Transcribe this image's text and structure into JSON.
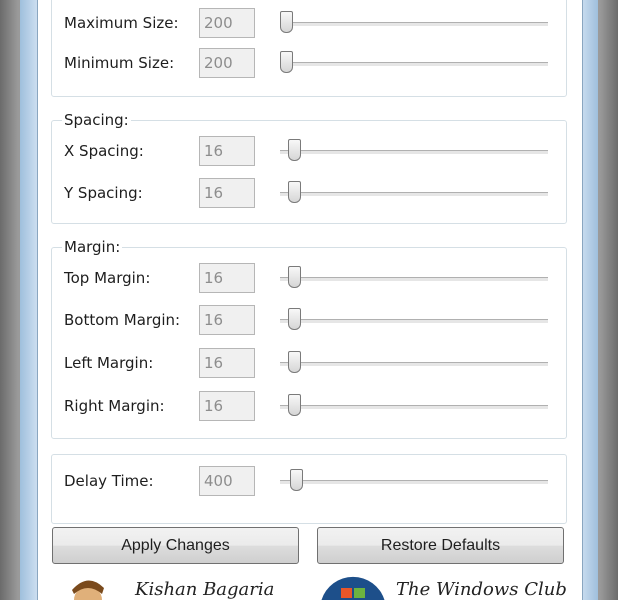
{
  "size_group": {
    "rows": [
      {
        "label": "Maximum Size:",
        "value": "200",
        "slider": 0
      },
      {
        "label": "Minimum Size:",
        "value": "200",
        "slider": 0
      }
    ]
  },
  "spacing_group": {
    "title": "Spacing:",
    "rows": [
      {
        "label": "X Spacing:",
        "value": "16",
        "slider": 0.03
      },
      {
        "label": "Y Spacing:",
        "value": "16",
        "slider": 0.03
      }
    ]
  },
  "margin_group": {
    "title": "Margin:",
    "rows": [
      {
        "label": "Top Margin:",
        "value": "16",
        "slider": 0.03
      },
      {
        "label": "Bottom Margin:",
        "value": "16",
        "slider": 0.03
      },
      {
        "label": "Left Margin:",
        "value": "16",
        "slider": 0.03
      },
      {
        "label": "Right Margin:",
        "value": "16",
        "slider": 0.03
      }
    ]
  },
  "delay_group": {
    "rows": [
      {
        "label": "Delay Time:",
        "value": "400",
        "slider": 0.04
      }
    ]
  },
  "buttons": {
    "apply": "Apply Changes",
    "restore": "Restore Defaults"
  },
  "footer": {
    "author": "Kishan Bagaria",
    "site": "The Windows Club"
  }
}
